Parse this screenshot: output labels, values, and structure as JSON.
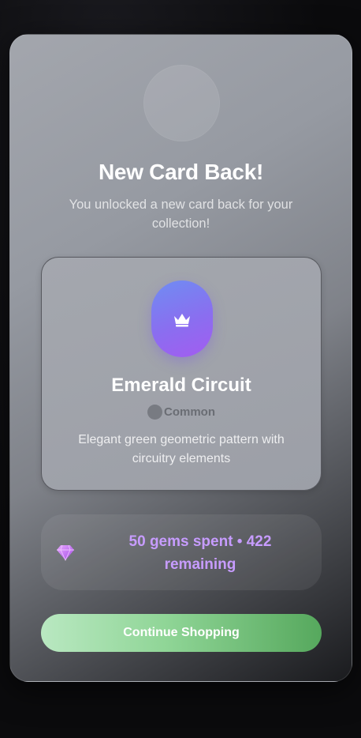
{
  "modal": {
    "title": "New Card Back!",
    "subtitle": "You unlocked a new card back for your collection!"
  },
  "card": {
    "icon": "crown-icon",
    "name": "Emerald Circuit",
    "rarity": "Common",
    "description": "Elegant green geometric pattern with circuitry elements"
  },
  "gems": {
    "icon": "gem-icon",
    "text": "50 gems spent • 422 remaining"
  },
  "actions": {
    "continue_label": "Continue Shopping"
  },
  "colors": {
    "accent_purple": "#c79cff",
    "badge_gradient_start": "#6f8df2",
    "badge_gradient_end": "#a35cf0",
    "button_gradient_start": "#b9e8c1",
    "button_gradient_end": "#56a85d"
  }
}
